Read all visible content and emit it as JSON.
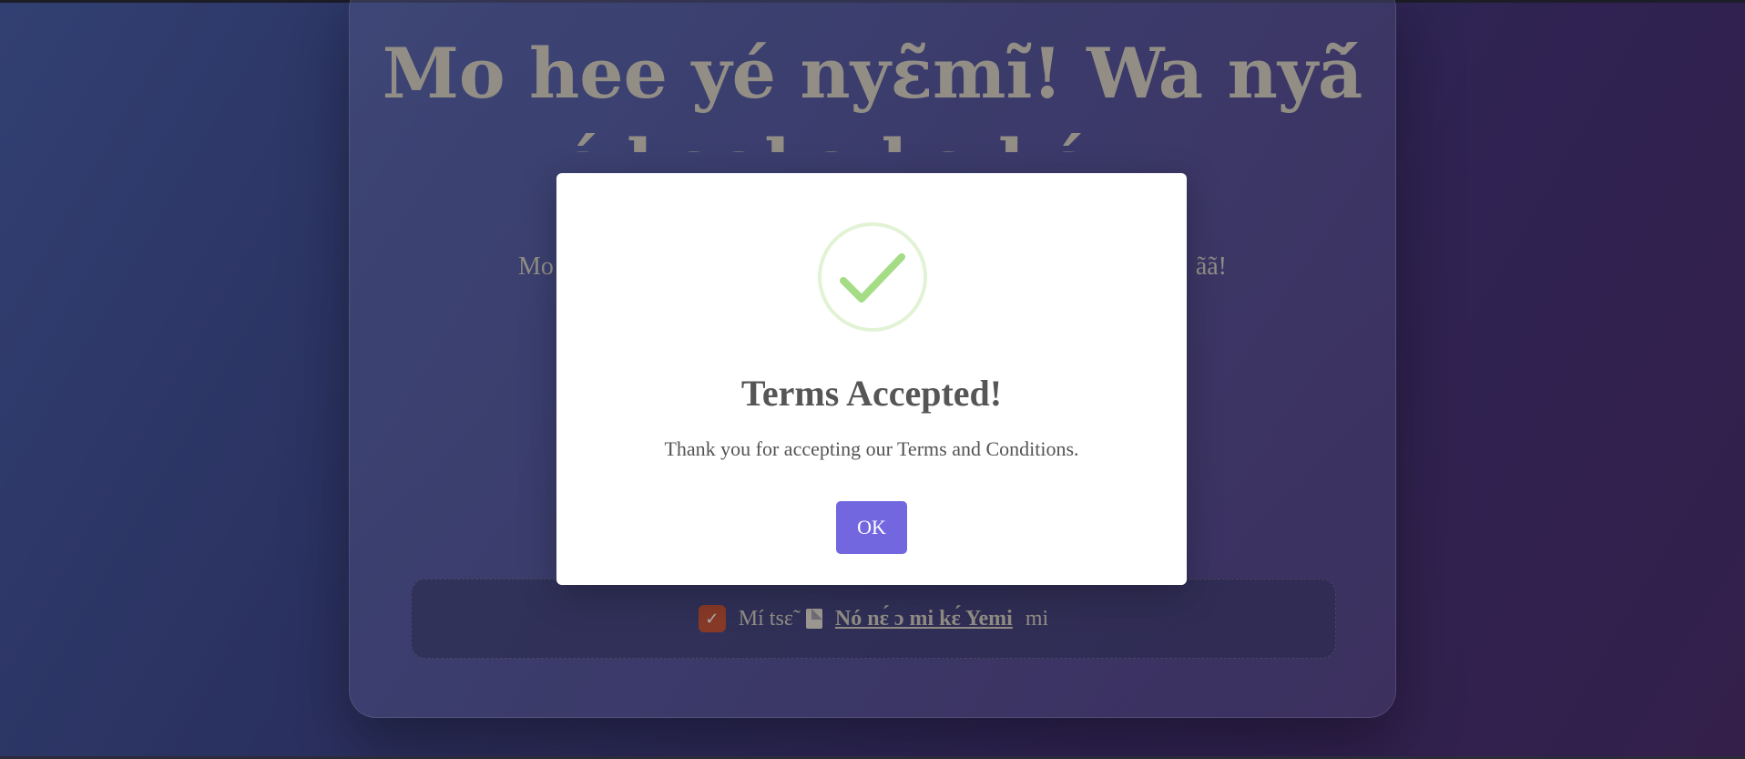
{
  "hero": {
    "title": "Mo hee yé nyɛ̃mĩ! Wa nyã́ ɛ́ kaaka ka kɛ́ ...",
    "subtitle_left": "Mo",
    "subtitle_right": "ãã!"
  },
  "consent": {
    "prefix": "Mí tsɛ̃",
    "link_text": "Nó nɛ́ ɔ mi kɛ́ Yemi",
    "suffix": "mi",
    "checked": true
  },
  "modal": {
    "title": "Terms Accepted!",
    "message": "Thank you for accepting our Terms and Conditions.",
    "ok_label": "OK",
    "icon": "check-icon"
  },
  "colors": {
    "accent": "#7367e0",
    "success": "#a5dc86",
    "checkbox": "#c8563a"
  }
}
